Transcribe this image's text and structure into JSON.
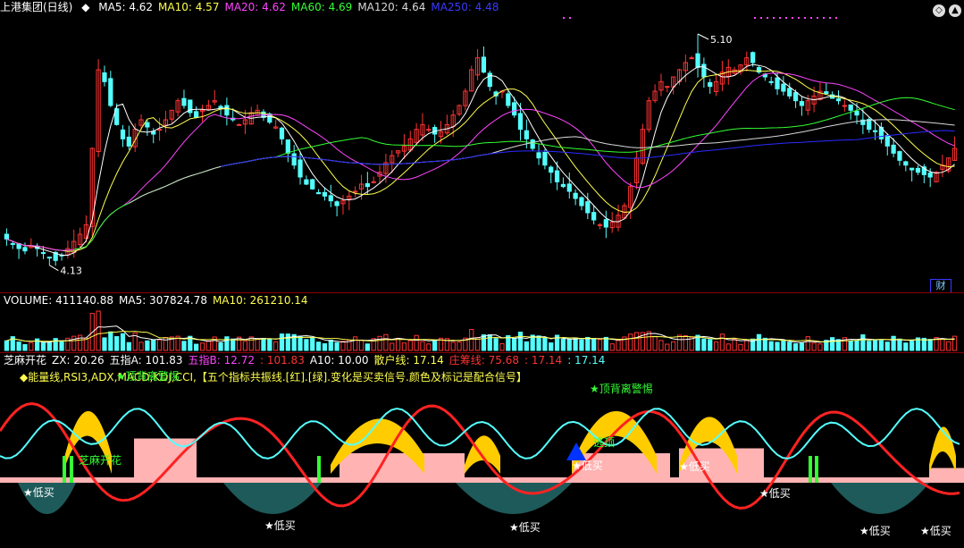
{
  "colors": {
    "up": "#ff3333",
    "down": "#54ffff",
    "bg": "#000000",
    "ma5": "#ffffff",
    "ma10": "#ffff4d",
    "ma20": "#ff44ff",
    "ma60": "#33ff33",
    "ma120": "#d8d8d8",
    "ma250": "#2a2aff",
    "vol_ma5": "#ffffff",
    "vol_ma10": "#ffff4d"
  },
  "main": {
    "title": "上港集团(日线)",
    "ma": [
      {
        "label": "MA5: 4.62",
        "color": "#ffffff"
      },
      {
        "label": "MA10: 4.57",
        "color": "#ffff4d"
      },
      {
        "label": "MA20: 4.62",
        "color": "#ff44ff"
      },
      {
        "label": "MA60: 4.69",
        "color": "#33ff33"
      },
      {
        "label": "MA120: 4.64",
        "color": "#d8d8d8"
      },
      {
        "label": "MA250: 4.48",
        "color": "#3a3aff"
      }
    ],
    "high_label": "5.10",
    "low_label": "4.13",
    "fin_label": "财",
    "ylim": [
      4.08,
      5.16
    ]
  },
  "volume": {
    "labels": [
      {
        "text": "VOLUME: 411140.88",
        "color": "#ffffff"
      },
      {
        "text": "MA5: 307824.78",
        "color": "#ffffff"
      },
      {
        "text": "MA10: 261210.14",
        "color": "#ffff4d"
      }
    ]
  },
  "indicator": {
    "labels": [
      {
        "text": "芝麻开花",
        "color": "#ffffff"
      },
      {
        "text": "ZX: 20.26",
        "color": "#ffffff"
      },
      {
        "text": "五指A: 101.83",
        "color": "#ffffff"
      },
      {
        "text": "五指B: 12.72",
        "color": "#ff44ff"
      },
      {
        "text": ": 101.83",
        "color": "#ff3333"
      },
      {
        "text": "A10: 10.00",
        "color": "#ffffff"
      },
      {
        "text": "散户线: 17.14",
        "color": "#ffff4d"
      },
      {
        "text": "庄筹线: 75.68",
        "color": "#ff3333"
      },
      {
        "text": ": 17.14",
        "color": "#ff3333"
      },
      {
        "text": ": 17.14",
        "color": "#54ffff"
      }
    ],
    "note": "◆能量线,RSI3,ADX,MACD,KDJ,CCI,【五个指标共振线.[红].[绿].变化是买卖信号.颜色及标记是配合信号】",
    "annotations": [
      {
        "text": "★顶背离警惕",
        "color": "#33ff33"
      },
      {
        "text": "★顶背离警惕",
        "color": "#33ff33"
      },
      {
        "text": "芝麻开花",
        "color": "#33ff33"
      },
      {
        "text": "逃顶",
        "color": "#33ff33"
      },
      {
        "text": "★低买",
        "color": "#ffffff"
      },
      {
        "text": "★低买",
        "color": "#ffffff"
      },
      {
        "text": "★低买",
        "color": "#ffffff"
      },
      {
        "text": "★低买",
        "color": "#ffffff"
      },
      {
        "text": "★低买",
        "color": "#ffffff"
      },
      {
        "text": "★低买",
        "color": "#ffffff"
      },
      {
        "text": "★低买",
        "color": "#ffffff"
      },
      {
        "text": "★低买",
        "color": "#ffffff"
      }
    ]
  },
  "chart_data": {
    "type": "candlestick",
    "title": "上港集团(日线)",
    "y_labeled_extremes": {
      "high": 5.1,
      "low": 4.13
    },
    "series": [
      {
        "name": "MA5",
        "last": 4.62
      },
      {
        "name": "MA10",
        "last": 4.57
      },
      {
        "name": "MA20",
        "last": 4.62
      },
      {
        "name": "MA60",
        "last": 4.69
      },
      {
        "name": "MA120",
        "last": 4.64
      },
      {
        "name": "MA250",
        "last": 4.48
      }
    ],
    "volume": {
      "last": 411140.88,
      "ma5": 307824.78,
      "ma10": 261210.14
    },
    "close": [
      4.24,
      4.22,
      4.2,
      4.19,
      4.21,
      4.2,
      4.18,
      4.16,
      4.15,
      4.17,
      4.2,
      4.23,
      4.26,
      4.3,
      4.62,
      4.95,
      4.9,
      4.8,
      4.72,
      4.66,
      4.63,
      4.7,
      4.74,
      4.71,
      4.68,
      4.7,
      4.74,
      4.78,
      4.82,
      4.8,
      4.77,
      4.75,
      4.78,
      4.8,
      4.82,
      4.79,
      4.76,
      4.74,
      4.72,
      4.74,
      4.77,
      4.78,
      4.75,
      4.73,
      4.71,
      4.66,
      4.6,
      4.55,
      4.5,
      4.47,
      4.45,
      4.43,
      4.42,
      4.4,
      4.38,
      4.4,
      4.42,
      4.44,
      4.47,
      4.46,
      4.48,
      4.52,
      4.56,
      4.59,
      4.61,
      4.63,
      4.66,
      4.7,
      4.72,
      4.7,
      4.68,
      4.69,
      4.72,
      4.76,
      4.8,
      4.86,
      4.95,
      5.0,
      4.94,
      4.88,
      4.84,
      4.86,
      4.8,
      4.76,
      4.7,
      4.66,
      4.62,
      4.58,
      4.55,
      4.52,
      4.48,
      4.46,
      4.44,
      4.41,
      4.38,
      4.35,
      4.32,
      4.3,
      4.29,
      4.31,
      4.34,
      4.38,
      4.46,
      4.58,
      4.7,
      4.82,
      4.86,
      4.9,
      4.88,
      4.92,
      4.95,
      4.98,
      5.0,
      4.96,
      4.92,
      4.88,
      4.9,
      4.94,
      4.96,
      4.95,
      4.97,
      5.0,
      4.98,
      4.94,
      4.92,
      4.9,
      4.87,
      4.86,
      4.84,
      4.82,
      4.8,
      4.82,
      4.84,
      4.86,
      4.85,
      4.83,
      4.82,
      4.8,
      4.78,
      4.76,
      4.72,
      4.7,
      4.69,
      4.66,
      4.63,
      4.6,
      4.57,
      4.55,
      4.53,
      4.52,
      4.51,
      4.5,
      4.52,
      4.55,
      4.58,
      4.62
    ]
  }
}
